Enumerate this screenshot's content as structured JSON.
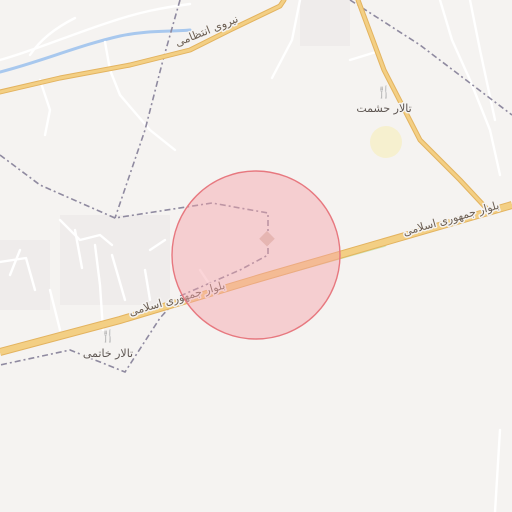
{
  "colors": {
    "background": "#f5f3f1",
    "main_road": "#f3cf84",
    "main_road_casing": "#e3b35f",
    "minor_road": "#ffffff",
    "river": "#a8c8ee",
    "boundary": "#8f8aa0",
    "circle_fill": "#f7a1a8",
    "circle_stroke": "#e7787f",
    "landuse_green": "#cfe5b0",
    "poi_icon": "#4a4340"
  },
  "roads": {
    "boulevard_label_right": "بلوار جمهوری اسلامی",
    "boulevard_label_left": "بلوار جمهوری اسلامی",
    "nirou_label": "نیروی انتظامی"
  },
  "pois": [
    {
      "name": "تالار حشمت",
      "icon": "restaurant-icon",
      "glyph": "🍴"
    },
    {
      "name": "تالار خاتمی",
      "icon": "restaurant-icon",
      "glyph": "🍴"
    }
  ]
}
